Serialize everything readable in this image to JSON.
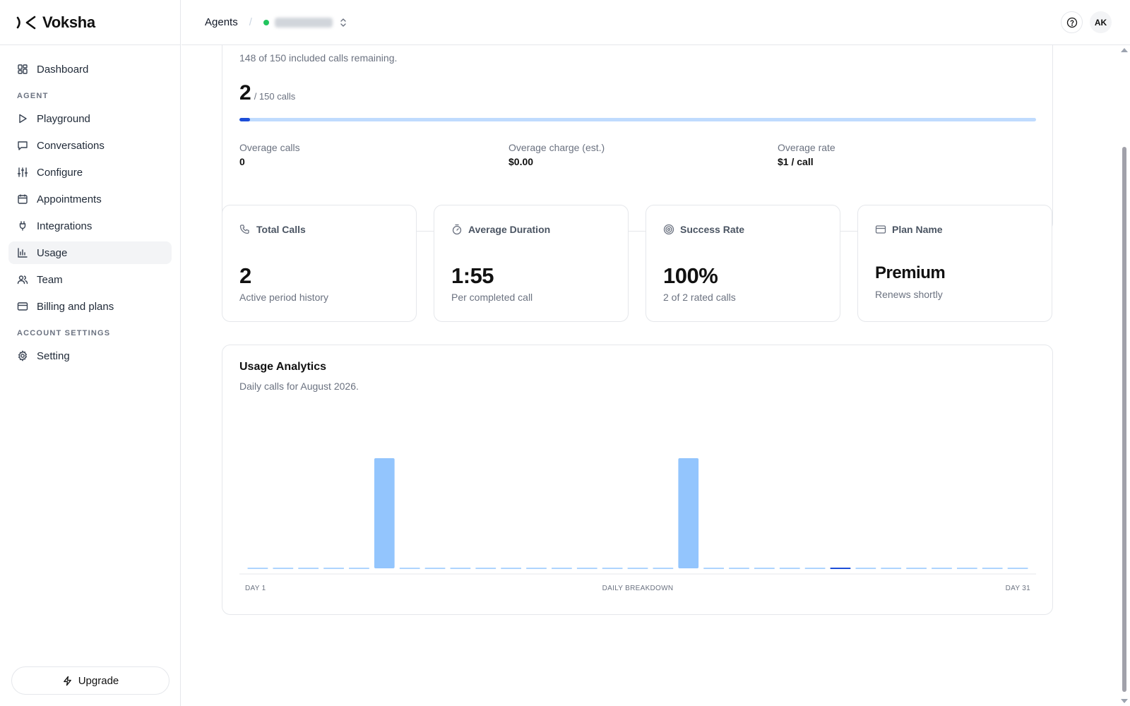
{
  "brand": {
    "name": "Voksha"
  },
  "sidebar": {
    "dashboard": "Dashboard",
    "section_agent": "AGENT",
    "items": [
      "Playground",
      "Conversations",
      "Configure",
      "Appointments",
      "Integrations",
      "Usage",
      "Team",
      "Billing and plans"
    ],
    "section_account": "ACCOUNT SETTINGS",
    "setting": "Setting",
    "upgrade": "Upgrade"
  },
  "header": {
    "crumb": "Agents",
    "separator": "/",
    "avatar": "AK"
  },
  "usage": {
    "remaining_text": "148 of 150 included calls remaining.",
    "calls_used": "2",
    "calls_suffix": "/ 150 calls",
    "progress_fraction": 0.0133,
    "overage_calls_label": "Overage calls",
    "overage_calls_value": "0",
    "overage_charge_label": "Overage charge (est.)",
    "overage_charge_value": "$0.00",
    "overage_rate_label": "Overage rate",
    "overage_rate_value": "$1 / call"
  },
  "stats": {
    "total_calls": {
      "label": "Total Calls",
      "value": "2",
      "sub": "Active period history"
    },
    "avg_duration": {
      "label": "Average Duration",
      "value": "1:55",
      "sub": "Per completed call"
    },
    "success_rate": {
      "label": "Success Rate",
      "value": "100%",
      "sub": "2 of 2 rated calls"
    },
    "plan": {
      "label": "Plan Name",
      "value": "Premium",
      "sub": "Renews shortly"
    }
  },
  "analytics": {
    "title": "Usage Analytics",
    "subtitle": "Daily calls for August 2026."
  },
  "colors": {
    "bar": "#93c5fd",
    "bar_highlight": "#1d4ed8",
    "accent": "#1d4ed8",
    "status_dot": "#22c55e"
  },
  "chart_data": {
    "type": "bar",
    "categories": [
      1,
      2,
      3,
      4,
      5,
      6,
      7,
      8,
      9,
      10,
      11,
      12,
      13,
      14,
      15,
      16,
      17,
      18,
      19,
      20,
      21,
      22,
      23,
      24,
      25,
      26,
      27,
      28,
      29,
      30,
      31
    ],
    "values": [
      0,
      0,
      0,
      0,
      0,
      1,
      0,
      0,
      0,
      0,
      0,
      0,
      0,
      0,
      0,
      0,
      0,
      1,
      0,
      0,
      0,
      0,
      0,
      0,
      0,
      0,
      0,
      0,
      0,
      0,
      0
    ],
    "highlight_day": 24,
    "ylim": [
      0,
      1
    ],
    "x_start_label": "DAY 1",
    "x_mid_label": "DAILY BREAKDOWN",
    "x_end_label": "DAY 31",
    "grid": false
  }
}
